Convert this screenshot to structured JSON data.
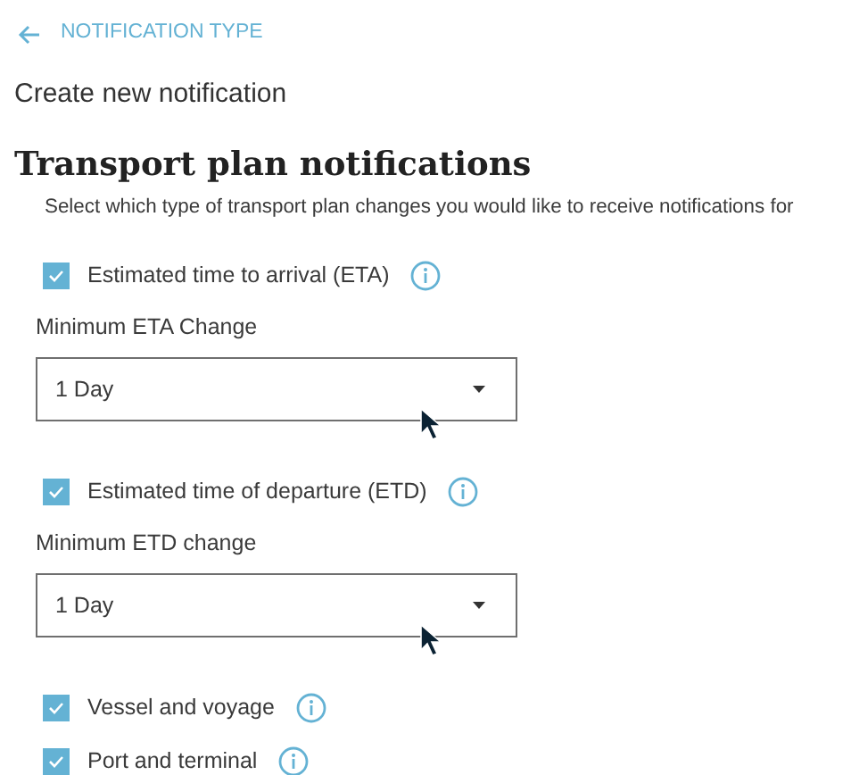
{
  "back_link": {
    "label": "NOTIFICATION TYPE"
  },
  "page_title": "Create new notification",
  "section": {
    "heading": "Transport plan notifications",
    "description": "Select which type of transport plan changes you would like to receive notifications for",
    "items": [
      {
        "kind": "checkbox",
        "label": "Estimated time to arrival (ETA)",
        "checked": true,
        "info": true
      },
      {
        "kind": "select",
        "label": "Minimum ETA Change",
        "value": "1 Day",
        "pointer": true
      },
      {
        "kind": "checkbox",
        "label": "Estimated time of departure (ETD)",
        "checked": true,
        "info": true
      },
      {
        "kind": "select",
        "label": "Minimum ETD change",
        "value": "1 Day",
        "pointer": true
      },
      {
        "kind": "checkbox",
        "label": "Vessel and voyage",
        "checked": true,
        "info": true
      },
      {
        "kind": "checkbox",
        "label": "Port and terminal",
        "checked": true,
        "info": true
      }
    ]
  }
}
